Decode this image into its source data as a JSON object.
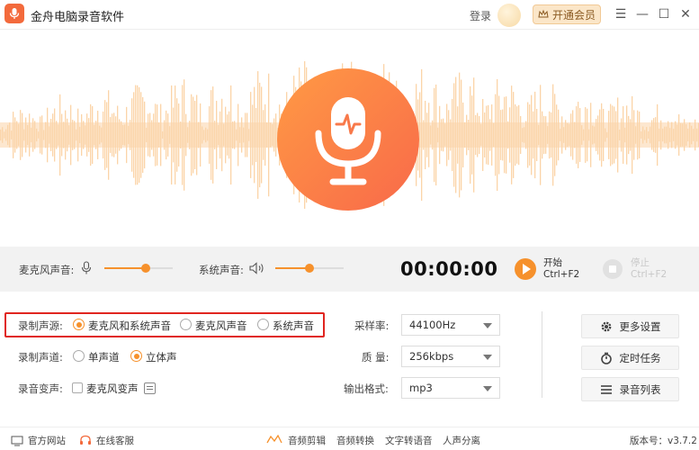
{
  "app": {
    "title": "金舟电脑录音软件",
    "login": "登录",
    "vip": "开通会员"
  },
  "window": {
    "menu_icon": "menu-icon",
    "min_icon": "minimize-icon",
    "max_icon": "maximize-icon",
    "close_icon": "close-icon"
  },
  "controls": {
    "mic_label": "麦克风声音:",
    "mic_level": 0.6,
    "sys_label": "系统声音:",
    "sys_level": 0.5,
    "timer": "00:00:00",
    "start_label": "开始",
    "start_shortcut": "Ctrl+F2",
    "stop_label": "停止",
    "stop_shortcut": "Ctrl+F2"
  },
  "settings": {
    "source_label": "录制声源:",
    "source_options": [
      "麦克风和系统声音",
      "麦克风声音",
      "系统声音"
    ],
    "source_selected": 0,
    "channel_label": "录制声道:",
    "channel_options": [
      "单声道",
      "立体声"
    ],
    "channel_selected": 1,
    "voice_label": "录音变声:",
    "voice_option": "麦克风变声",
    "sample_label": "采样率:",
    "sample_value": "44100Hz",
    "quality_label": "质 量:",
    "quality_value": "256kbps",
    "format_label": "输出格式:",
    "format_value": "mp3"
  },
  "side_buttons": {
    "more": "更多设置",
    "timer_task": "定时任务",
    "list": "录音列表"
  },
  "footer": {
    "website": "官方网站",
    "service": "在线客服",
    "tools": [
      "音频剪辑",
      "音频转换",
      "文字转语音",
      "人声分离"
    ],
    "version": "版本号：v3.7.2"
  },
  "colors": {
    "accent": "#f6912c",
    "brand": "#f36a3c",
    "wave": "#fbd4a8",
    "highlight": "#e0251f"
  }
}
